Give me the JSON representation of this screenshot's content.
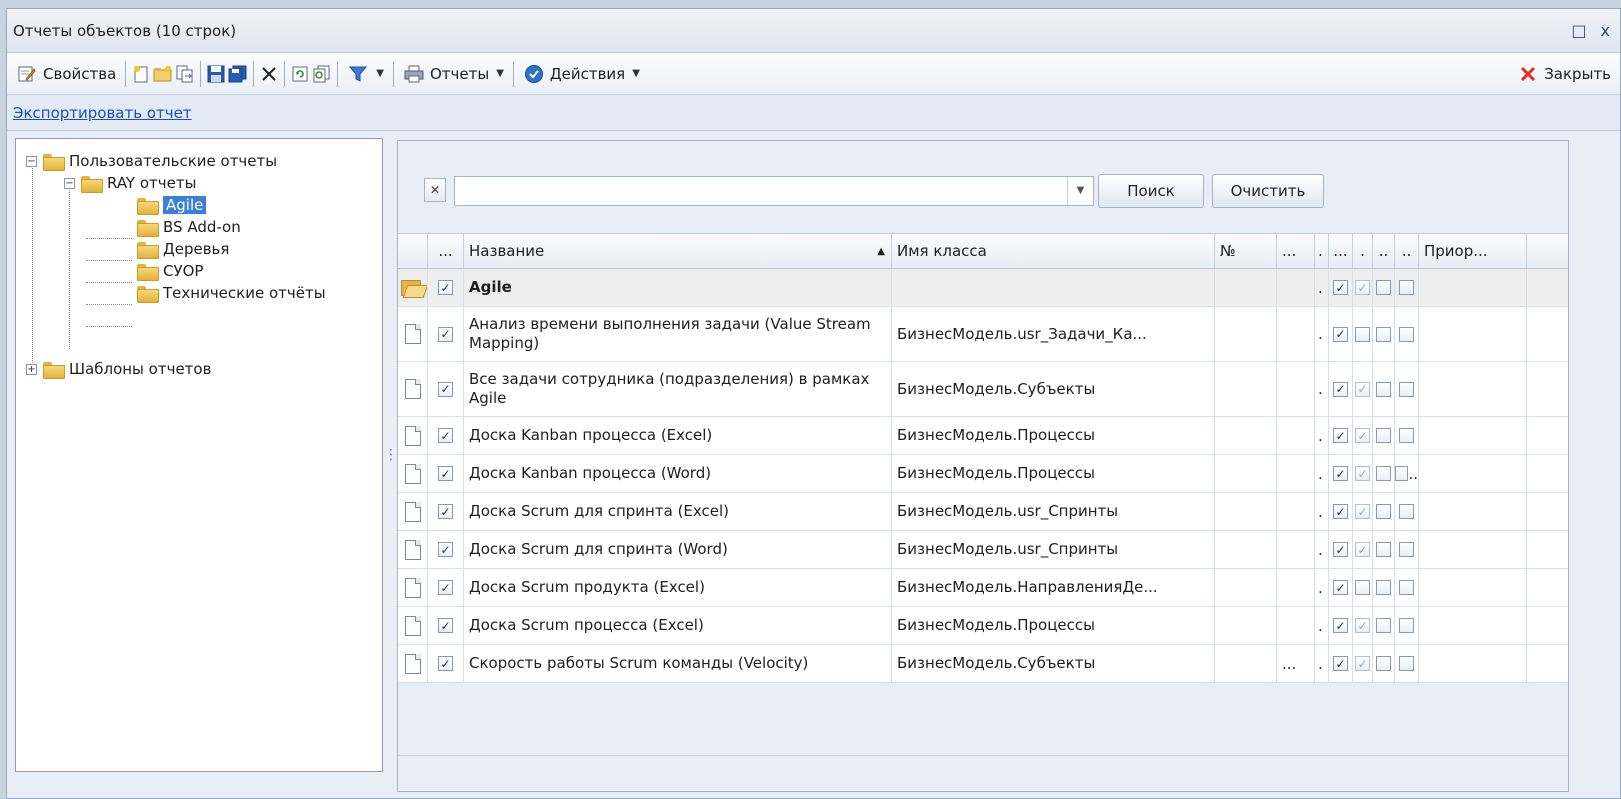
{
  "window": {
    "title": "Отчеты объектов (10 строк)",
    "restore_glyph": "□",
    "close_glyph": "x"
  },
  "toolbar": {
    "properties_label": "Свойства",
    "reports_label": "Отчеты",
    "actions_label": "Действия",
    "close_label": "Закрыть"
  },
  "linkbar": {
    "export_label": "Экспортировать отчет"
  },
  "tree": {
    "nodes": [
      {
        "label": "Пользовательские отчеты",
        "expander": "−"
      },
      {
        "label": "RAY отчеты",
        "expander": "−"
      },
      {
        "label": "Agile"
      },
      {
        "label": "BS Add-on"
      },
      {
        "label": "Деревья"
      },
      {
        "label": "СУОР"
      },
      {
        "label": "Технические отчёты"
      },
      {
        "label": "Шаблоны отчетов",
        "expander": "+"
      }
    ]
  },
  "search": {
    "clear_glyph": "✕",
    "value": "",
    "search_label": "Поиск",
    "clear_label": "Очистить"
  },
  "grid": {
    "headers": {
      "ellipsis": "...",
      "name": "Название",
      "class": "Имя класса",
      "num": "№",
      "d1": "...",
      "d2": ".",
      "b1": "...",
      "b2": ".",
      "b3": "..",
      "b4": "..",
      "priority": "Приор..."
    },
    "rows": [
      {
        "name": "Agile",
        "class": "",
        "d1": "",
        "d2": ".",
        "b4": ""
      },
      {
        "name": "Анализ времени выполнения задачи (Value Stream Mapping)",
        "class": "БизнесМодель.usr_Задачи_Ка...",
        "d1": "",
        "d2": ".",
        "b4": ""
      },
      {
        "name": "Все задачи сотрудника (подразделения) в рамках Agile",
        "class": "БизнесМодель.Субъекты",
        "d1": "",
        "d2": ".",
        "b4": ""
      },
      {
        "name": "Доска Kanban процесса (Excel)",
        "class": "БизнесМодель.Процессы",
        "d1": "",
        "d2": ".",
        "b4": ""
      },
      {
        "name": "Доска Kanban процесса (Word)",
        "class": "БизнесМодель.Процессы",
        "d1": "",
        "d2": ".",
        "b4": ".."
      },
      {
        "name": "Доска Scrum для спринта (Excel)",
        "class": "БизнесМодель.usr_Спринты",
        "d1": "",
        "d2": ".",
        "b4": ""
      },
      {
        "name": "Доска Scrum для спринта (Word)",
        "class": "БизнесМодель.usr_Спринты",
        "d1": "",
        "d2": ".",
        "b4": ""
      },
      {
        "name": "Доска Scrum продукта (Excel)",
        "class": "БизнесМодель.НаправленияДе...",
        "d1": "",
        "d2": ".",
        "b4": ""
      },
      {
        "name": "Доска Scrum процесса (Excel)",
        "class": "БизнесМодель.Процессы",
        "d1": "",
        "d2": ".",
        "b4": ""
      },
      {
        "name": "Скорость работы Scrum команды (Velocity)",
        "class": "БизнесМодель.Субъекты",
        "d1": "...",
        "d2": ".",
        "b4": ""
      }
    ]
  }
}
